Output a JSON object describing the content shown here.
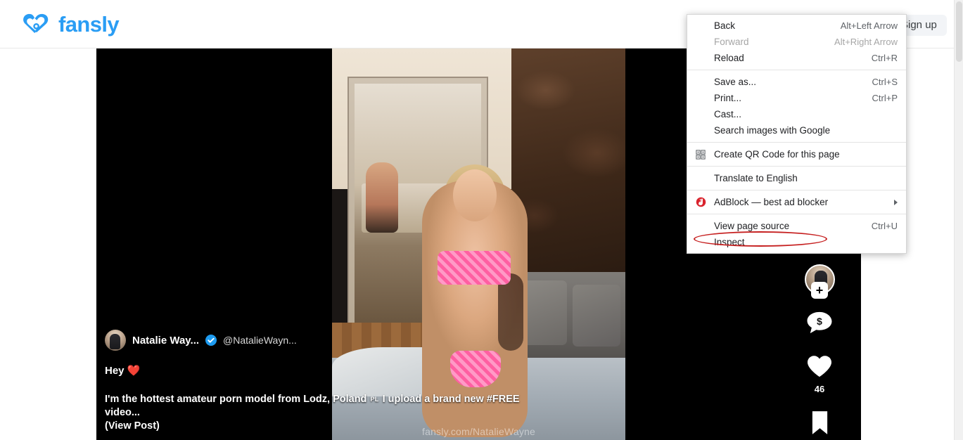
{
  "header": {
    "brand_name": "fansly",
    "brand_color": "#2a9df4",
    "signup_label": "Sign up"
  },
  "post": {
    "display_name": "Natalie Way...",
    "handle": "@NatalieWayn...",
    "verified_badge": "verified-icon",
    "greeting": "Hey",
    "greeting_emoji": "❤️",
    "description_part1": "I'm the hottest amateur porn model from Lodz, Poland",
    "country_badge": "PL",
    "description_part2": "I upload a brand new",
    "hashtag": "#FREE",
    "description_part3": "video...",
    "view_post_label": "(View Post)",
    "watermark": "fansly.com/NatalieWayne"
  },
  "rail": {
    "follow_plus": "+",
    "tip_icon": "dollar-bubble-icon",
    "like_icon": "heart-icon",
    "like_count": "46",
    "bookmark_icon": "bookmark-icon"
  },
  "context_menu": {
    "highlighted_item": "Inspect",
    "highlight_color": "#c62020",
    "groups": [
      {
        "items": [
          {
            "label": "Back",
            "accel": "Alt+Left Arrow",
            "icon": "",
            "disabled": false,
            "submenu": false
          },
          {
            "label": "Forward",
            "accel": "Alt+Right Arrow",
            "icon": "",
            "disabled": true,
            "submenu": false
          },
          {
            "label": "Reload",
            "accel": "Ctrl+R",
            "icon": "",
            "disabled": false,
            "submenu": false
          }
        ]
      },
      {
        "items": [
          {
            "label": "Save as...",
            "accel": "Ctrl+S",
            "icon": "",
            "disabled": false,
            "submenu": false
          },
          {
            "label": "Print...",
            "accel": "Ctrl+P",
            "icon": "",
            "disabled": false,
            "submenu": false
          },
          {
            "label": "Cast...",
            "accel": "",
            "icon": "",
            "disabled": false,
            "submenu": false
          },
          {
            "label": "Search images with Google",
            "accel": "",
            "icon": "",
            "disabled": false,
            "submenu": false
          }
        ]
      },
      {
        "items": [
          {
            "label": "Create QR Code for this page",
            "accel": "",
            "icon": "qr-code-icon",
            "disabled": false,
            "submenu": false
          }
        ]
      },
      {
        "items": [
          {
            "label": "Translate to English",
            "accel": "",
            "icon": "",
            "disabled": false,
            "submenu": false
          }
        ]
      },
      {
        "items": [
          {
            "label": "AdBlock — best ad blocker",
            "accel": "",
            "icon": "adblock-icon",
            "disabled": false,
            "submenu": true
          }
        ]
      },
      {
        "items": [
          {
            "label": "View page source",
            "accel": "Ctrl+U",
            "icon": "",
            "disabled": false,
            "submenu": false
          },
          {
            "label": "Inspect",
            "accel": "",
            "icon": "",
            "disabled": false,
            "submenu": false
          }
        ]
      }
    ]
  }
}
